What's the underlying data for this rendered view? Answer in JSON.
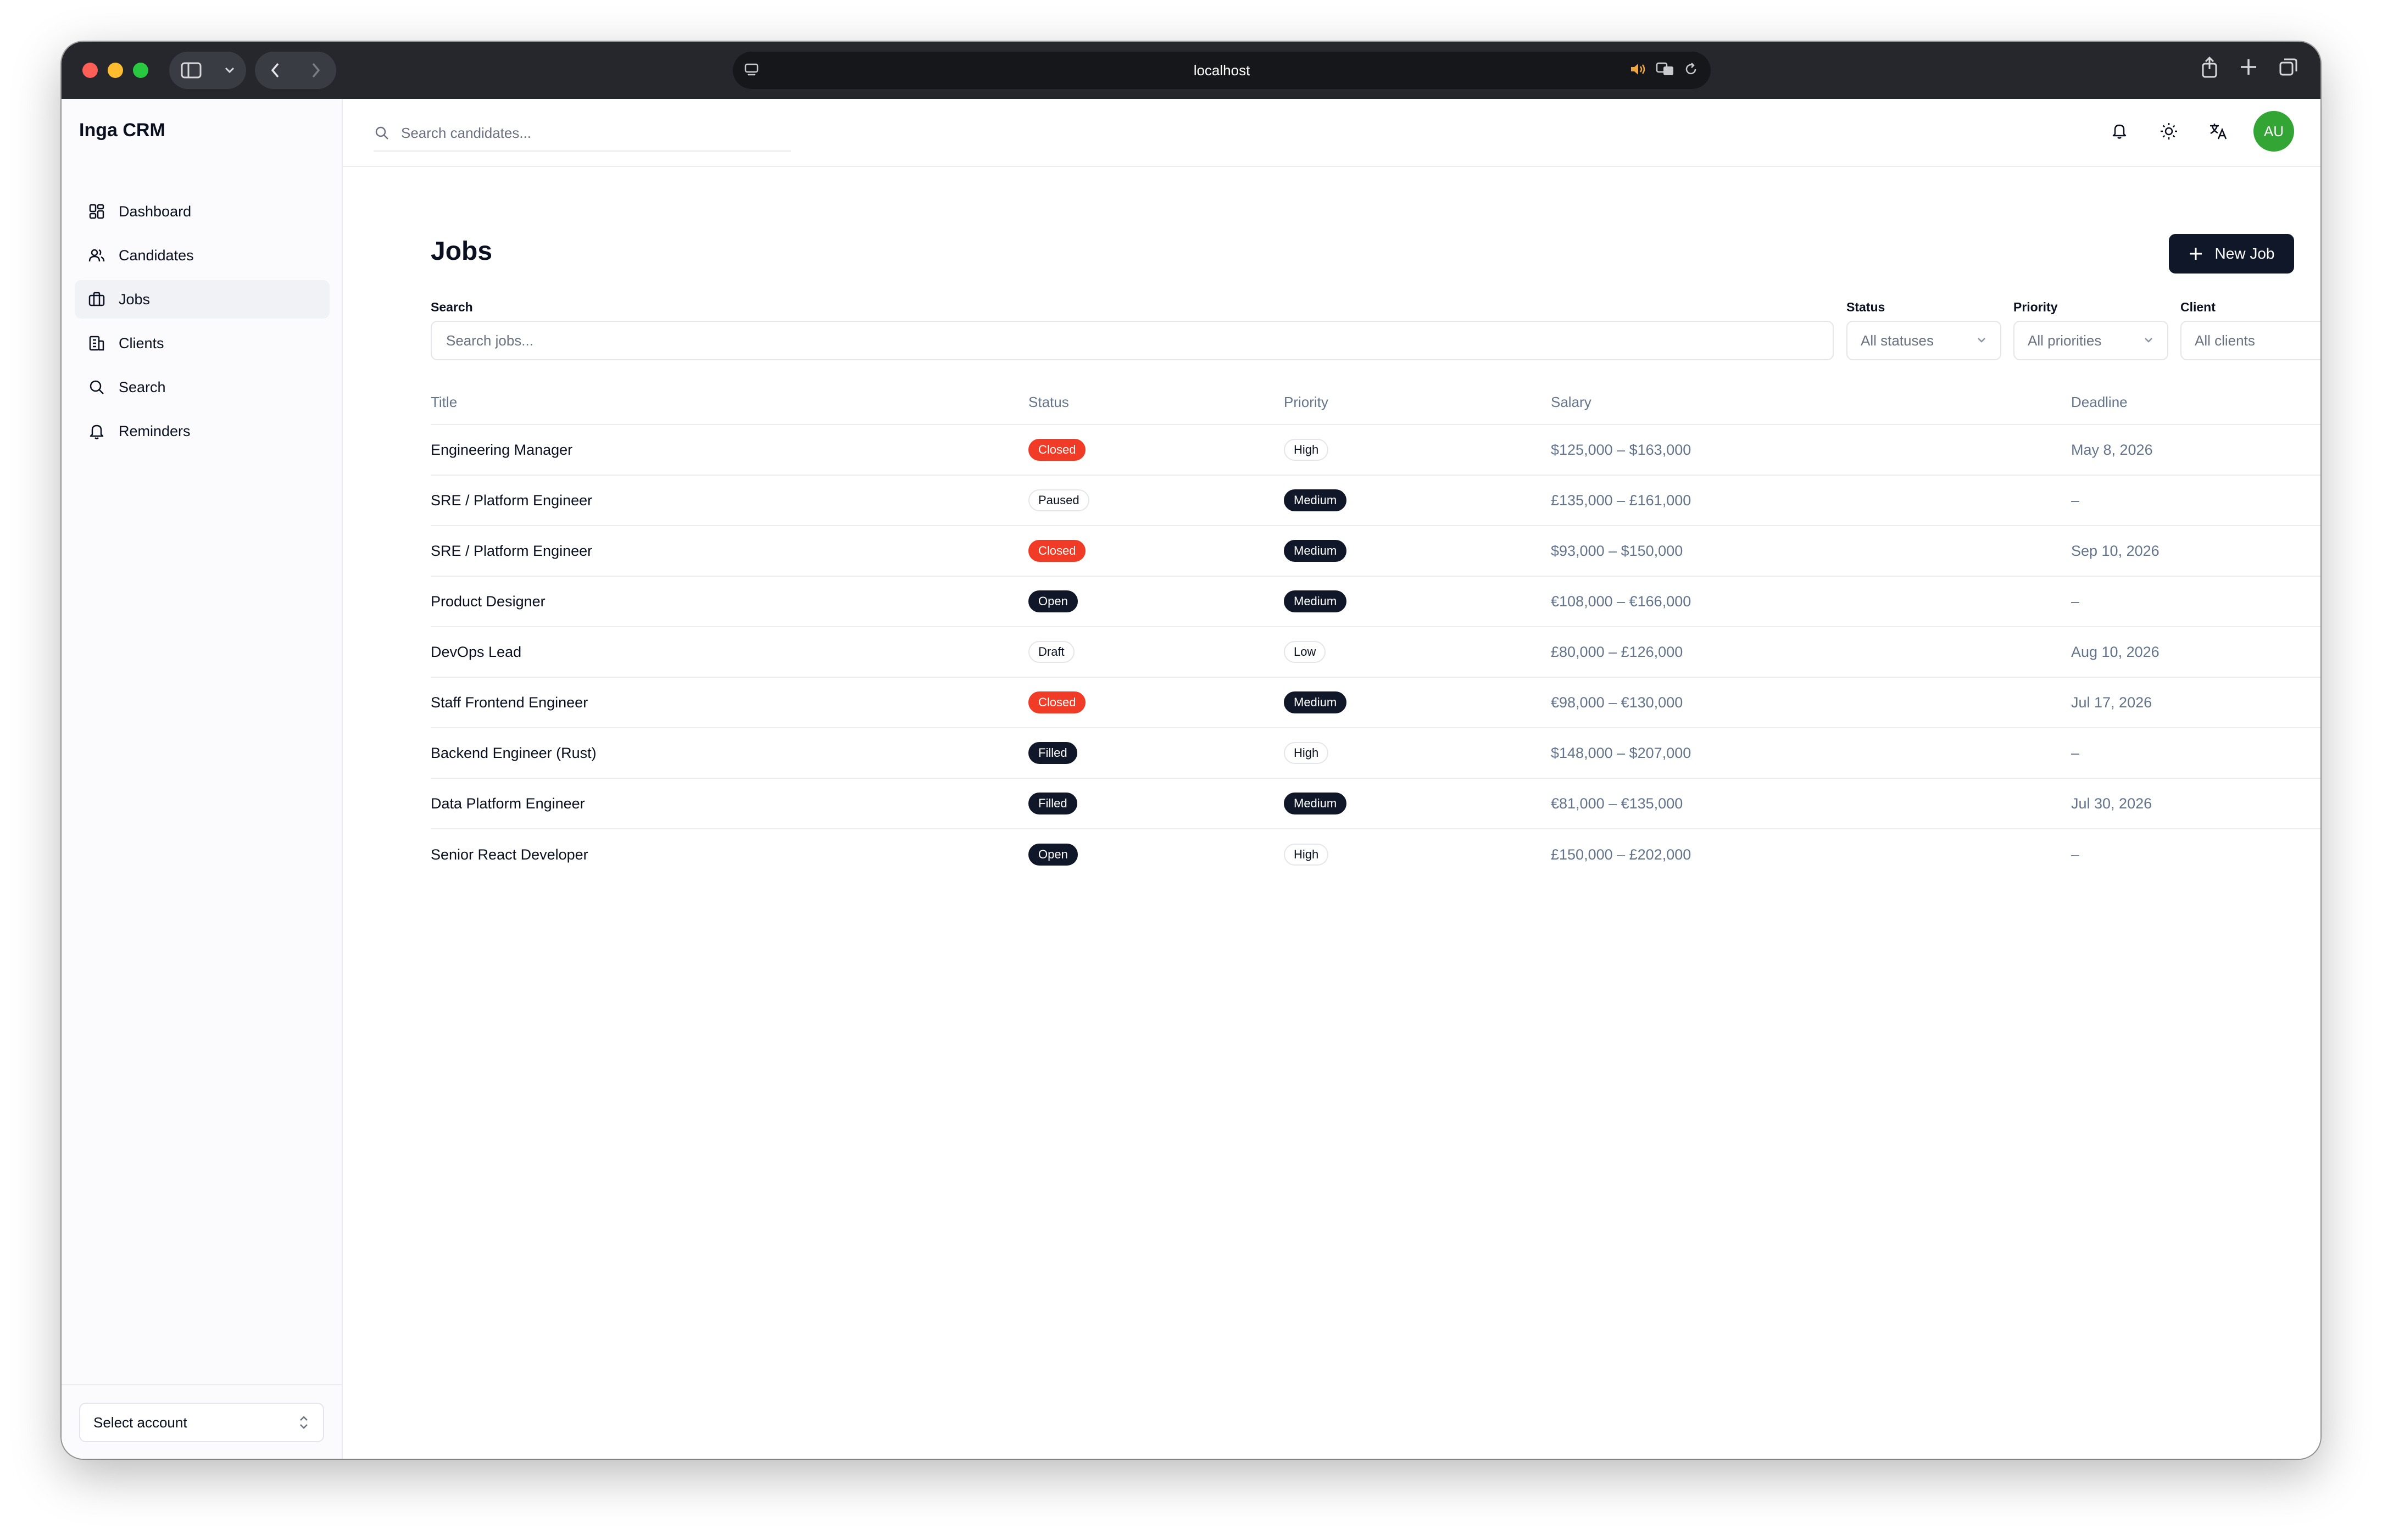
{
  "browser": {
    "url": "localhost"
  },
  "app": {
    "brand": "Inga CRM",
    "top_search_placeholder": "Search candidates...",
    "avatar_initials": "AU",
    "avatar_color": "#33a534"
  },
  "sidebar": {
    "items": [
      {
        "label": "Dashboard",
        "icon": "dashboard-icon",
        "active": false
      },
      {
        "label": "Candidates",
        "icon": "users-icon",
        "active": false
      },
      {
        "label": "Jobs",
        "icon": "briefcase-icon",
        "active": true
      },
      {
        "label": "Clients",
        "icon": "building-icon",
        "active": false
      },
      {
        "label": "Search",
        "icon": "search-icon",
        "active": false
      },
      {
        "label": "Reminders",
        "icon": "bell-icon",
        "active": false
      }
    ],
    "account_select": "Select account"
  },
  "page": {
    "title": "Jobs",
    "new_job_label": "New Job"
  },
  "filters": {
    "search_label": "Search",
    "search_placeholder": "Search jobs...",
    "status_label": "Status",
    "status_value": "All statuses",
    "priority_label": "Priority",
    "priority_value": "All priorities",
    "client_label": "Client",
    "client_value": "All clients"
  },
  "table": {
    "columns": [
      "Title",
      "Status",
      "Priority",
      "Salary",
      "Deadline"
    ],
    "rows": [
      {
        "title": "Engineering Manager",
        "status": "Closed",
        "priority": "High",
        "salary": "$125,000 – $163,000",
        "deadline": "May 8, 2026"
      },
      {
        "title": "SRE / Platform Engineer",
        "status": "Paused",
        "priority": "Medium",
        "salary": "£135,000 – £161,000",
        "deadline": "–"
      },
      {
        "title": "SRE / Platform Engineer",
        "status": "Closed",
        "priority": "Medium",
        "salary": "$93,000 – $150,000",
        "deadline": "Sep 10, 2026"
      },
      {
        "title": "Product Designer",
        "status": "Open",
        "priority": "Medium",
        "salary": "€108,000 – €166,000",
        "deadline": "–"
      },
      {
        "title": "DevOps Lead",
        "status": "Draft",
        "priority": "Low",
        "salary": "£80,000 – £126,000",
        "deadline": "Aug 10, 2026"
      },
      {
        "title": "Staff Frontend Engineer",
        "status": "Closed",
        "priority": "Medium",
        "salary": "€98,000 – €130,000",
        "deadline": "Jul 17, 2026"
      },
      {
        "title": "Backend Engineer (Rust)",
        "status": "Filled",
        "priority": "High",
        "salary": "$148,000 – $207,000",
        "deadline": "–"
      },
      {
        "title": "Data Platform Engineer",
        "status": "Filled",
        "priority": "Medium",
        "salary": "€81,000 – €135,000",
        "deadline": "Jul 30, 2026"
      },
      {
        "title": "Senior React Developer",
        "status": "Open",
        "priority": "High",
        "salary": "£150,000 – £202,000",
        "deadline": "–"
      }
    ]
  },
  "colors": {
    "closed": "#f03b26",
    "dark_badge": "#0f1729",
    "primary_button": "#0f1729"
  }
}
